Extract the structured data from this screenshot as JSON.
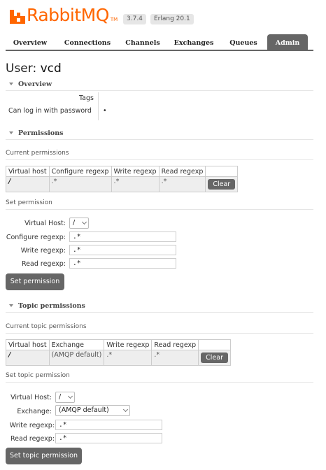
{
  "header": {
    "logo_text": "RabbitMQ",
    "logo_tm": "TM",
    "version": "3.7.4",
    "erlang": "Erlang 20.1"
  },
  "nav": {
    "tabs": [
      {
        "label": "Overview"
      },
      {
        "label": "Connections"
      },
      {
        "label": "Channels"
      },
      {
        "label": "Exchanges"
      },
      {
        "label": "Queues"
      },
      {
        "label": "Admin",
        "active": true
      }
    ]
  },
  "page": {
    "title_prefix": "User:",
    "title_user": "vcd"
  },
  "overview": {
    "heading": "Overview",
    "tags_label": "Tags",
    "tags_value": "",
    "login_label": "Can log in with password",
    "login_value": "•"
  },
  "permissions": {
    "heading": "Permissions",
    "current_heading": "Current permissions",
    "columns": [
      "Virtual host",
      "Configure regexp",
      "Write regexp",
      "Read regexp"
    ],
    "rows": [
      {
        "vhost": "/",
        "configure": ".*",
        "write": ".*",
        "read": ".*",
        "action": "Clear"
      }
    ],
    "set_heading": "Set permission",
    "form": {
      "vhost_label": "Virtual Host:",
      "vhost_value": "/",
      "configure_label": "Configure regexp:",
      "configure_value": ".*",
      "write_label": "Write regexp:",
      "write_value": ".*",
      "read_label": "Read regexp:",
      "read_value": ".*",
      "submit": "Set permission"
    }
  },
  "topic_permissions": {
    "heading": "Topic permissions",
    "current_heading": "Current topic permissions",
    "columns": [
      "Virtual host",
      "Exchange",
      "Write regexp",
      "Read regexp"
    ],
    "rows": [
      {
        "vhost": "/",
        "exchange": "(AMQP default)",
        "write": ".*",
        "read": ".*",
        "action": "Clear"
      }
    ],
    "set_heading": "Set topic permission",
    "form": {
      "vhost_label": "Virtual Host:",
      "vhost_value": "/",
      "exchange_label": "Exchange:",
      "exchange_value": "(AMQP default)",
      "write_label": "Write regexp:",
      "write_value": ".*",
      "read_label": "Read regexp:",
      "read_value": ".*",
      "submit": "Set topic permission"
    }
  },
  "colors": {
    "brand": "#ff6600",
    "tab_active": "#666666",
    "button": "#666666"
  }
}
